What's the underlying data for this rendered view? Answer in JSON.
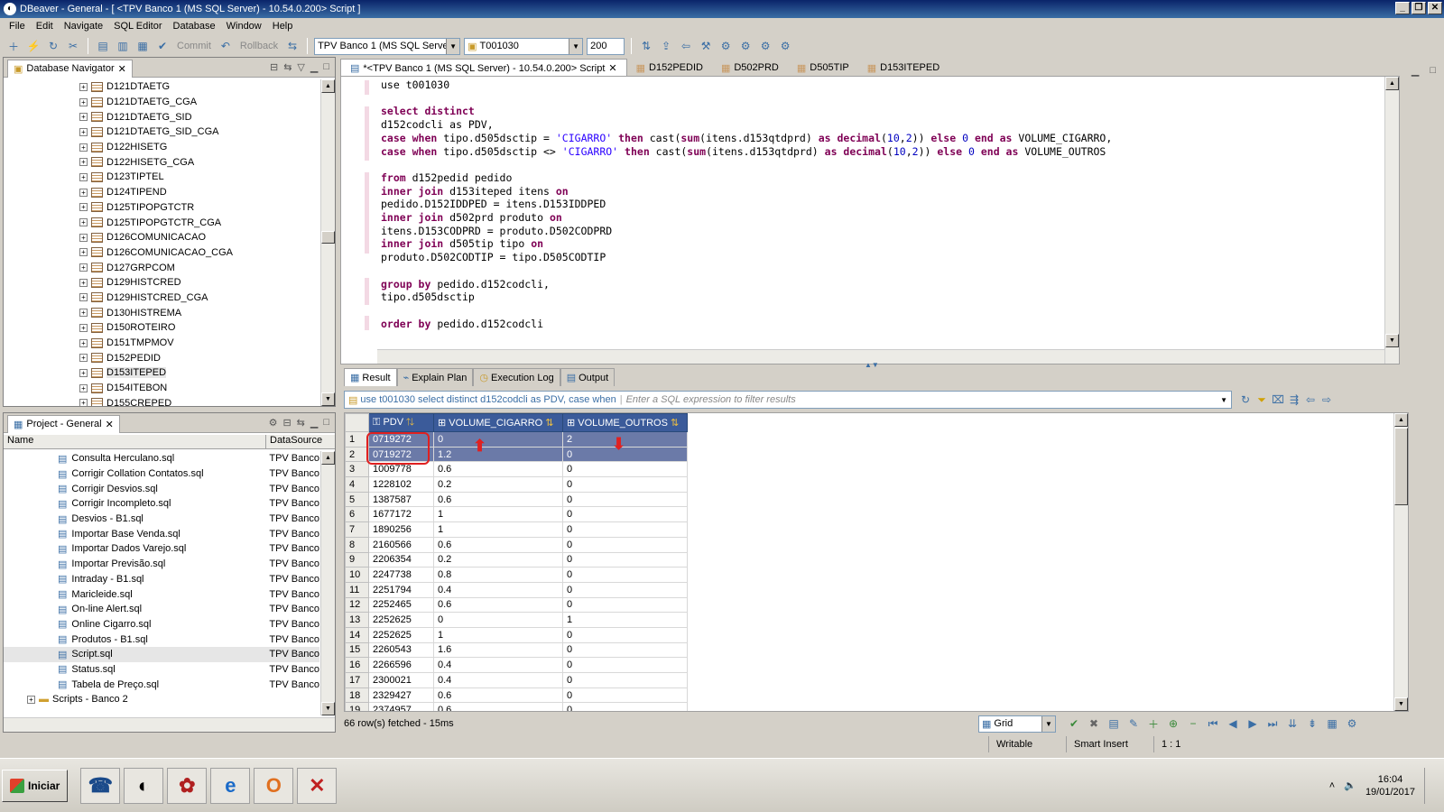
{
  "window": {
    "title": "DBeaver - General - [ <TPV Banco 1 (MS SQL Server) - 10.54.0.200> Script ]"
  },
  "menu": [
    "File",
    "Edit",
    "Navigate",
    "SQL Editor",
    "Database",
    "Window",
    "Help"
  ],
  "toolbar": {
    "commit_label": "Commit",
    "rollback_label": "Rollback",
    "connection": "TPV Banco 1 (MS SQL Serve",
    "schema": "T001030",
    "max_rows": "200"
  },
  "navigator": {
    "title": "Database Navigator",
    "items": [
      "D121DTAETG",
      "D121DTAETG_CGA",
      "D121DTAETG_SID",
      "D121DTAETG_SID_CGA",
      "D122HISETG",
      "D122HISETG_CGA",
      "D123TIPTEL",
      "D124TIPEND",
      "D125TIPOPGTCTR",
      "D125TIPOPGTCTR_CGA",
      "D126COMUNICACAO",
      "D126COMUNICACAO_CGA",
      "D127GRPCOM",
      "D129HISTCRED",
      "D129HISTCRED_CGA",
      "D130HISTREMA",
      "D150ROTEIRO",
      "D151TMPMOV",
      "D152PEDID",
      "D153ITEPED",
      "D154ITEBON",
      "D155CREPED"
    ],
    "selected": "D153ITEPED"
  },
  "project": {
    "title": "Project - General",
    "col_name": "Name",
    "col_datasource": "DataSource",
    "files": [
      {
        "name": "Consulta Herculano.sql",
        "ds": "TPV Banco"
      },
      {
        "name": "Corrigir Collation Contatos.sql",
        "ds": "TPV Banco"
      },
      {
        "name": "Corrigir Desvios.sql",
        "ds": "TPV Banco"
      },
      {
        "name": "Corrigir Incompleto.sql",
        "ds": "TPV Banco"
      },
      {
        "name": "Desvios - B1.sql",
        "ds": "TPV Banco"
      },
      {
        "name": "Importar Base Venda.sql",
        "ds": "TPV Banco"
      },
      {
        "name": "Importar Dados Varejo.sql",
        "ds": "TPV Banco"
      },
      {
        "name": "Importar Previsão.sql",
        "ds": "TPV Banco"
      },
      {
        "name": "Intraday - B1.sql",
        "ds": "TPV Banco"
      },
      {
        "name": "Maricleide.sql",
        "ds": "TPV Banco"
      },
      {
        "name": "On-line Alert.sql",
        "ds": "TPV Banco"
      },
      {
        "name": "Online Cigarro.sql",
        "ds": "TPV Banco"
      },
      {
        "name": "Produtos - B1.sql",
        "ds": "TPV Banco"
      },
      {
        "name": "Script.sql",
        "ds": "TPV Banco"
      },
      {
        "name": "Status.sql",
        "ds": "TPV Banco"
      },
      {
        "name": "Tabela de Preço.sql",
        "ds": "TPV Banco"
      }
    ],
    "folder": "Scripts - Banco 2",
    "selected": "Script.sql"
  },
  "editor_tabs": [
    "*<TPV Banco 1 (MS SQL Server) - 10.54.0.200> Script",
    "D152PEDID",
    "D502PRD",
    "D505TIP",
    "D153ITEPED"
  ],
  "sql": {
    "use": "use t001030",
    "lines": [
      "d152codcli as PDV,",
      "pedido.D152IDDPED = itens.D153IDDPED",
      "itens.D153CODPRD = produto.D502CODPRD",
      "produto.D502CODTIP = tipo.D505CODTIP",
      "tipo.d505dsctip"
    ]
  },
  "results": {
    "tabs": [
      "Result",
      "Explain Plan",
      "Execution Log",
      "Output"
    ],
    "query_preview": "use t001030 select distinct d152codcli as PDV, case when",
    "filter_placeholder": "Enter a SQL expression to filter results",
    "columns": [
      "PDV",
      "VOLUME_CIGARRO",
      "VOLUME_OUTROS"
    ],
    "rows": [
      [
        "1",
        "0719272",
        "0",
        "2"
      ],
      [
        "2",
        "0719272",
        "1.2",
        "0"
      ],
      [
        "3",
        "1009778",
        "0.6",
        "0"
      ],
      [
        "4",
        "1228102",
        "0.2",
        "0"
      ],
      [
        "5",
        "1387587",
        "0.6",
        "0"
      ],
      [
        "6",
        "1677172",
        "1",
        "0"
      ],
      [
        "7",
        "1890256",
        "1",
        "0"
      ],
      [
        "8",
        "2160566",
        "0.6",
        "0"
      ],
      [
        "9",
        "2206354",
        "0.2",
        "0"
      ],
      [
        "10",
        "2247738",
        "0.8",
        "0"
      ],
      [
        "11",
        "2251794",
        "0.4",
        "0"
      ],
      [
        "12",
        "2252465",
        "0.6",
        "0"
      ],
      [
        "13",
        "2252625",
        "0",
        "1"
      ],
      [
        "14",
        "2252625",
        "1",
        "0"
      ],
      [
        "15",
        "2260543",
        "1.6",
        "0"
      ],
      [
        "16",
        "2266596",
        "0.4",
        "0"
      ],
      [
        "17",
        "2300021",
        "0.4",
        "0"
      ],
      [
        "18",
        "2329427",
        "0.6",
        "0"
      ],
      [
        "19",
        "2374957",
        "0.6",
        "0"
      ]
    ],
    "status": "66 row(s) fetched - 15ms",
    "view_mode": "Grid"
  },
  "statusbar": {
    "writable": "Writable",
    "insert": "Smart Insert",
    "pos": "1 : 1"
  },
  "taskbar": {
    "start": "Iniciar",
    "time": "16:04",
    "date": "19/01/2017"
  }
}
